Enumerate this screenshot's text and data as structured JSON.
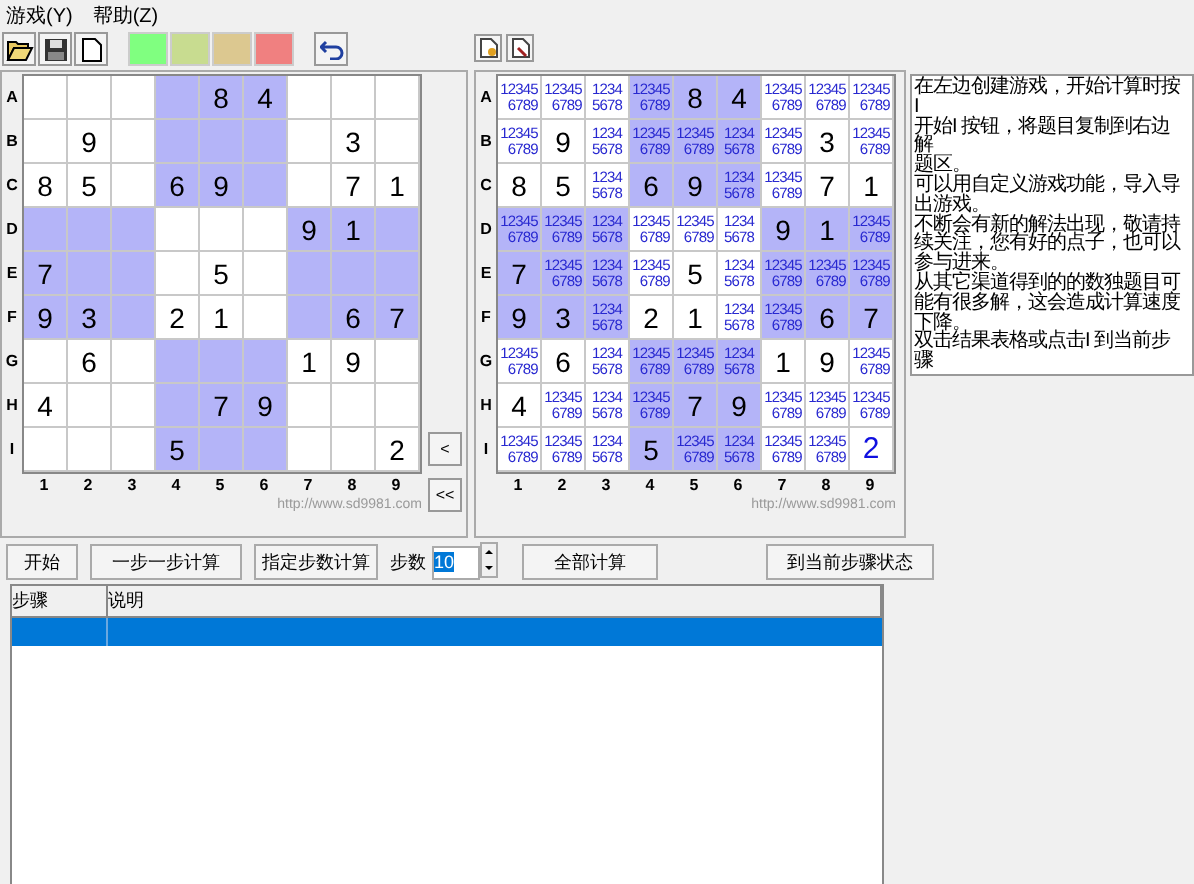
{
  "menu": [
    {
      "label": "游戏(Y)"
    },
    {
      "label": "帮助(Z)"
    }
  ],
  "toolbar": {
    "swatches": [
      {
        "color": "#80ff80"
      },
      {
        "color": "#c8dc90"
      },
      {
        "color": "#dcc890"
      },
      {
        "color": "#f08080"
      }
    ]
  },
  "left_board": {
    "row_labels": [
      "A",
      "B",
      "C",
      "D",
      "E",
      "F",
      "G",
      "H",
      "I"
    ],
    "col_labels": [
      "1",
      "2",
      "3",
      "4",
      "5",
      "6",
      "7",
      "8",
      "9"
    ],
    "rows": [
      [
        "",
        "",
        "",
        "",
        "8",
        "4",
        "",
        "",
        ""
      ],
      [
        "",
        "9",
        "",
        "",
        "",
        "",
        "",
        "3",
        ""
      ],
      [
        "8",
        "5",
        "",
        "6",
        "9",
        "",
        "",
        "7",
        "1"
      ],
      [
        "",
        "",
        "",
        "",
        "",
        "",
        "9",
        "1",
        ""
      ],
      [
        "7",
        "",
        "",
        "",
        "5",
        "",
        "",
        "",
        ""
      ],
      [
        "9",
        "3",
        "",
        "2",
        "1",
        "",
        "",
        "6",
        "7"
      ],
      [
        "",
        "6",
        "",
        "",
        "",
        "",
        "1",
        "9",
        ""
      ],
      [
        "4",
        "",
        "",
        "",
        "7",
        "9",
        "",
        "",
        ""
      ],
      [
        "",
        "",
        "",
        "5",
        "",
        "",
        "",
        "",
        "2"
      ]
    ],
    "url": "http://www.sd9981.com",
    "nav_buttons": [
      "<",
      "<<"
    ]
  },
  "right_board": {
    "row_labels": [
      "A",
      "B",
      "C",
      "D",
      "E",
      "F",
      "G",
      "H",
      "I"
    ],
    "col_labels": [
      "1",
      "2",
      "3",
      "4",
      "5",
      "6",
      "7",
      "8",
      "9"
    ],
    "rows": [
      [
        {
          "kind": "candidates",
          "lines": [
            "12345",
            "6789"
          ]
        },
        {
          "kind": "candidates",
          "lines": [
            "12345",
            "6789"
          ]
        },
        {
          "kind": "candidates",
          "lines": [
            "1234",
            "5678"
          ]
        },
        {
          "kind": "candidates",
          "lines": [
            "12345",
            "6789"
          ]
        },
        {
          "kind": "given",
          "text": "8"
        },
        {
          "kind": "given",
          "text": "4"
        },
        {
          "kind": "candidates",
          "lines": [
            "12345",
            "6789"
          ]
        },
        {
          "kind": "candidates",
          "lines": [
            "12345",
            "6789"
          ]
        },
        {
          "kind": "candidates",
          "lines": [
            "12345",
            "6789"
          ]
        }
      ],
      [
        {
          "kind": "candidates",
          "lines": [
            "12345",
            "6789"
          ]
        },
        {
          "kind": "given",
          "text": "9"
        },
        {
          "kind": "candidates",
          "lines": [
            "1234",
            "5678"
          ]
        },
        {
          "kind": "candidates",
          "lines": [
            "12345",
            "6789"
          ]
        },
        {
          "kind": "candidates",
          "lines": [
            "12345",
            "6789"
          ]
        },
        {
          "kind": "candidates",
          "lines": [
            "1234",
            "5678"
          ]
        },
        {
          "kind": "candidates",
          "lines": [
            "12345",
            "6789"
          ]
        },
        {
          "kind": "given",
          "text": "3"
        },
        {
          "kind": "candidates",
          "lines": [
            "12345",
            "6789"
          ]
        }
      ],
      [
        {
          "kind": "given",
          "text": "8"
        },
        {
          "kind": "given",
          "text": "5"
        },
        {
          "kind": "candidates",
          "lines": [
            "1234",
            "5678"
          ]
        },
        {
          "kind": "given",
          "text": "6"
        },
        {
          "kind": "given",
          "text": "9"
        },
        {
          "kind": "candidates",
          "lines": [
            "1234",
            "5678"
          ]
        },
        {
          "kind": "candidates",
          "lines": [
            "12345",
            "6789"
          ]
        },
        {
          "kind": "given",
          "text": "7"
        },
        {
          "kind": "given",
          "text": "1"
        }
      ],
      [
        {
          "kind": "candidates",
          "lines": [
            "12345",
            "6789"
          ]
        },
        {
          "kind": "candidates",
          "lines": [
            "12345",
            "6789"
          ]
        },
        {
          "kind": "candidates",
          "lines": [
            "1234",
            "5678"
          ]
        },
        {
          "kind": "candidates",
          "lines": [
            "12345",
            "6789"
          ]
        },
        {
          "kind": "candidates",
          "lines": [
            "12345",
            "6789"
          ]
        },
        {
          "kind": "candidates",
          "lines": [
            "1234",
            "5678"
          ]
        },
        {
          "kind": "given",
          "text": "9"
        },
        {
          "kind": "given",
          "text": "1"
        },
        {
          "kind": "candidates",
          "lines": [
            "12345",
            "6789"
          ]
        }
      ],
      [
        {
          "kind": "given",
          "text": "7"
        },
        {
          "kind": "candidates",
          "lines": [
            "12345",
            "6789"
          ]
        },
        {
          "kind": "candidates",
          "lines": [
            "1234",
            "5678"
          ]
        },
        {
          "kind": "candidates",
          "lines": [
            "12345",
            "6789"
          ]
        },
        {
          "kind": "given",
          "text": "5"
        },
        {
          "kind": "candidates",
          "lines": [
            "1234",
            "5678"
          ]
        },
        {
          "kind": "candidates",
          "lines": [
            "12345",
            "6789"
          ]
        },
        {
          "kind": "candidates",
          "lines": [
            "12345",
            "6789"
          ]
        },
        {
          "kind": "candidates",
          "lines": [
            "12345",
            "6789"
          ]
        }
      ],
      [
        {
          "kind": "given",
          "text": "9"
        },
        {
          "kind": "given",
          "text": "3"
        },
        {
          "kind": "candidates",
          "lines": [
            "1234",
            "5678"
          ]
        },
        {
          "kind": "given",
          "text": "2"
        },
        {
          "kind": "given",
          "text": "1"
        },
        {
          "kind": "candidates",
          "lines": [
            "1234",
            "5678"
          ]
        },
        {
          "kind": "candidates",
          "lines": [
            "12345",
            "6789"
          ]
        },
        {
          "kind": "given",
          "text": "6"
        },
        {
          "kind": "given",
          "text": "7"
        }
      ],
      [
        {
          "kind": "candidates",
          "lines": [
            "12345",
            "6789"
          ]
        },
        {
          "kind": "given",
          "text": "6"
        },
        {
          "kind": "candidates",
          "lines": [
            "1234",
            "5678"
          ]
        },
        {
          "kind": "candidates",
          "lines": [
            "12345",
            "6789"
          ]
        },
        {
          "kind": "candidates",
          "lines": [
            "12345",
            "6789"
          ]
        },
        {
          "kind": "candidates",
          "lines": [
            "1234",
            "5678"
          ]
        },
        {
          "kind": "given",
          "text": "1"
        },
        {
          "kind": "given",
          "text": "9"
        },
        {
          "kind": "candidates",
          "lines": [
            "12345",
            "6789"
          ]
        }
      ],
      [
        {
          "kind": "given",
          "text": "4"
        },
        {
          "kind": "candidates",
          "lines": [
            "12345",
            "6789"
          ]
        },
        {
          "kind": "candidates",
          "lines": [
            "1234",
            "5678"
          ]
        },
        {
          "kind": "candidates",
          "lines": [
            "12345",
            "6789"
          ]
        },
        {
          "kind": "given",
          "text": "7"
        },
        {
          "kind": "given",
          "text": "9"
        },
        {
          "kind": "candidates",
          "lines": [
            "12345",
            "6789"
          ]
        },
        {
          "kind": "candidates",
          "lines": [
            "12345",
            "6789"
          ]
        },
        {
          "kind": "candidates",
          "lines": [
            "12345",
            "6789"
          ]
        }
      ],
      [
        {
          "kind": "candidates",
          "lines": [
            "12345",
            "6789"
          ]
        },
        {
          "kind": "candidates",
          "lines": [
            "12345",
            "6789"
          ]
        },
        {
          "kind": "candidates",
          "lines": [
            "1234",
            "5678"
          ]
        },
        {
          "kind": "given",
          "text": "5"
        },
        {
          "kind": "candidates",
          "lines": [
            "12345",
            "6789"
          ]
        },
        {
          "kind": "candidates",
          "lines": [
            "1234",
            "5678"
          ]
        },
        {
          "kind": "candidates",
          "lines": [
            "12345",
            "6789"
          ]
        },
        {
          "kind": "candidates",
          "lines": [
            "12345",
            "6789"
          ]
        },
        {
          "kind": "found",
          "text": "2"
        }
      ]
    ],
    "url": "http://www.sd9981.com"
  },
  "help_text": {
    "lines": [
      "在左边创建游戏，开始计算时按",
      "I",
      "开始I 按钮，将题目复制到右边",
      "解",
      "题区。",
      "可以用自定义游戏功能，导入导",
      "出游戏。",
      "不断会有新的解法出现，敬请持",
      "续关注，您有好的点子，也可以",
      "参与进来。",
      "从其它渠道得到的的数独题目可",
      "能有很多解，这会造成计算速度",
      "下降。",
      "双击结果表格或点击I 到当前步",
      "骤"
    ]
  },
  "controls": {
    "start": "开始",
    "step": "一步一步计算",
    "step_n": "指定步数计算",
    "steps_label": "步数",
    "steps_value": "10",
    "all": "全部计算",
    "goto": "到当前步骤状态"
  },
  "table": {
    "columns": [
      "步骤",
      "说明"
    ],
    "rows": [
      {
        "selected": true
      }
    ]
  }
}
